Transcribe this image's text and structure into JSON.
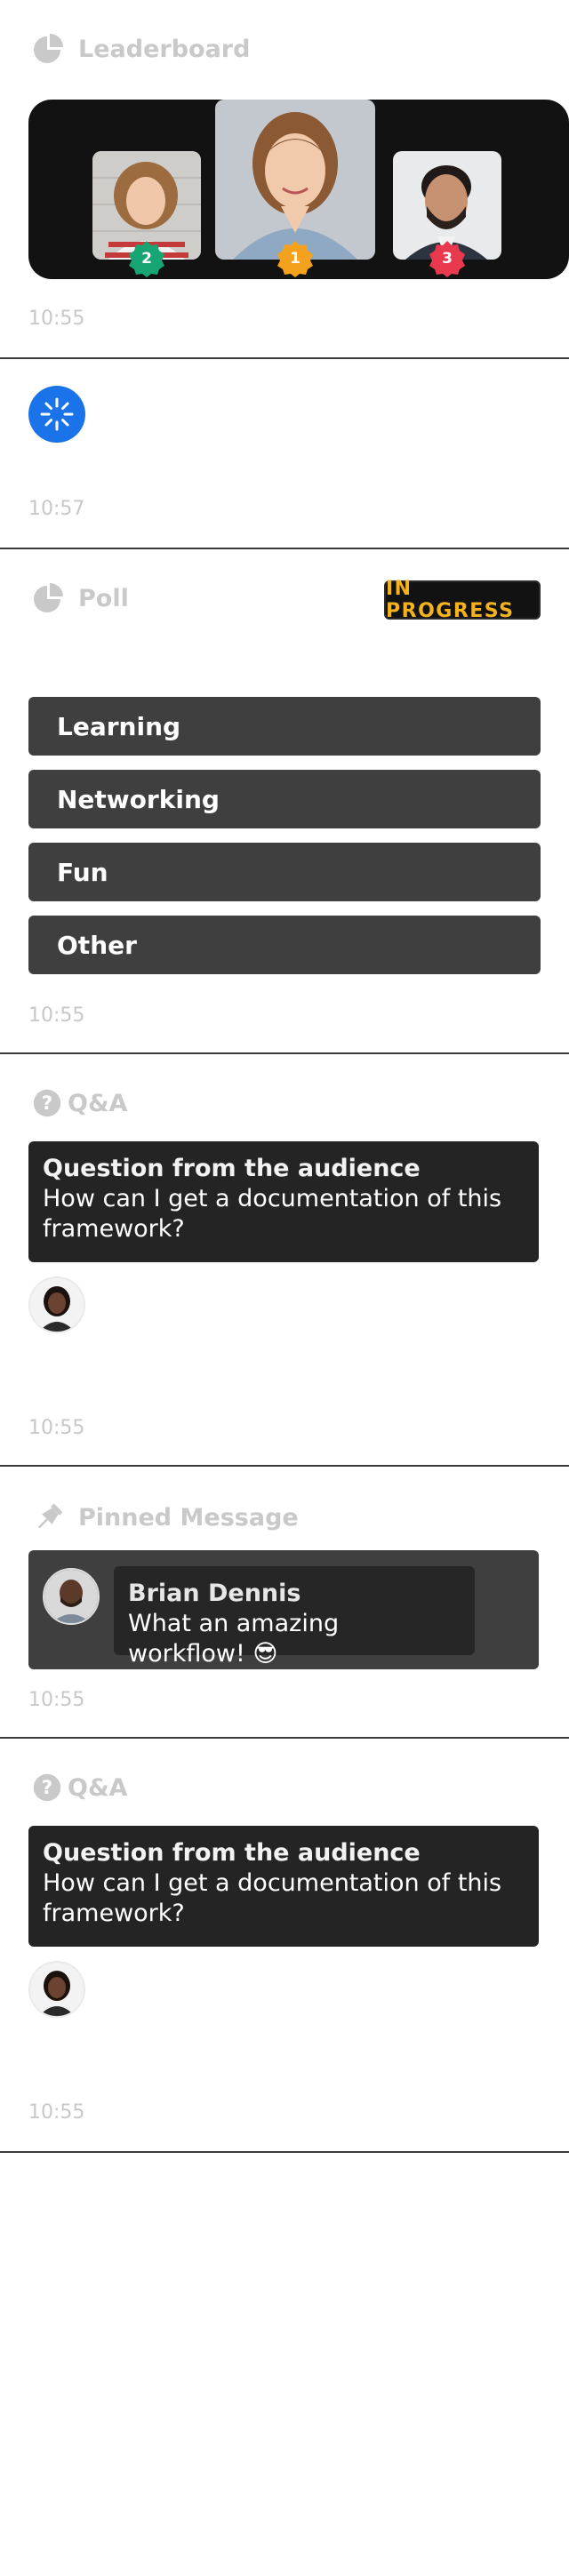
{
  "leaderboard": {
    "title": "Leaderboard",
    "time": "10:55",
    "places": [
      {
        "rank": "2",
        "badge_color": "#17a673"
      },
      {
        "rank": "1",
        "badge_color": "#f4a21d"
      },
      {
        "rank": "3",
        "badge_color": "#e8394f"
      }
    ]
  },
  "loading": {
    "time": "10:57",
    "spinner_color": "#1a73e8"
  },
  "poll": {
    "title": "Poll",
    "status": "IN PROGRESS",
    "status_color": "#f4b21d",
    "options": [
      "Learning",
      "Networking",
      "Fun",
      "Other"
    ],
    "time": "10:55"
  },
  "qa_1": {
    "title": "Q&A",
    "question_title": "Question from the audience",
    "question_text": "How can I get a documentation of this framework?",
    "time": "10:55"
  },
  "pinned": {
    "title": "Pinned Message",
    "author": "Brian Dennis",
    "message": "What an amazing workflow! 😎",
    "time": "10:55"
  },
  "qa_2": {
    "title": "Q&A",
    "question_title": "Question from the audience",
    "question_text": "How can I get a documentation of this framework?",
    "time": "10:55"
  }
}
